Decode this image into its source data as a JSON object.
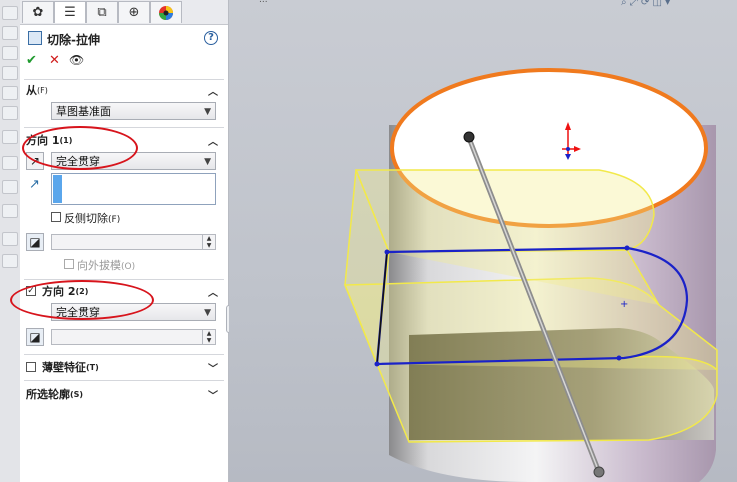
{
  "feature": {
    "title": "切除-拉伸",
    "help": "?",
    "ok": "✔",
    "cancel": "✕",
    "preview": "👁"
  },
  "tabs": [
    "feature-manager",
    "property-manager",
    "configuration-manager",
    "dim-xpert-manager",
    "display-manager"
  ],
  "from": {
    "header": "从",
    "shortcut": "(F)",
    "value": "草图基准面"
  },
  "direction1": {
    "header": "方向 1",
    "shortcut": "(1)",
    "end_condition": "完全贯穿",
    "reverse_label": "反侧切除",
    "reverse_shortcut": "(F)",
    "draft_outward_label": "向外拔模",
    "draft_outward_shortcut": "(O)"
  },
  "direction2": {
    "header": "方向 2",
    "shortcut": "(2)",
    "checked": true,
    "end_condition": "完全贯穿"
  },
  "thin_feature": {
    "header": "薄壁特征",
    "shortcut": "(T)"
  },
  "selected_contours": {
    "header": "所选轮廓",
    "shortcut": "(S)"
  },
  "colors": {
    "cut_outline": "#f2e94a",
    "sketch": "#1a22c8",
    "top_face_edge": "#f07a1e",
    "highlight_oval": "#d7141c",
    "body": "#c8c8cc"
  }
}
